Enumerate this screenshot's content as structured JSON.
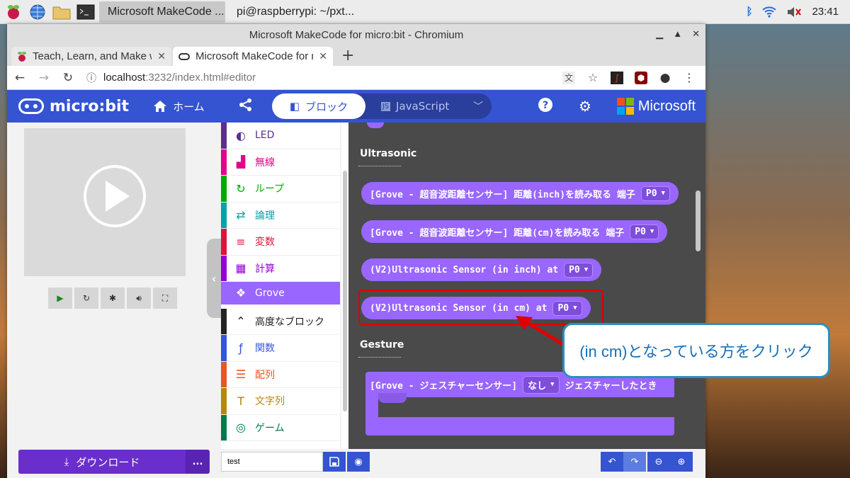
{
  "taskbar": {
    "tasks": [
      {
        "label": "Microsoft MakeCode ...",
        "active": true
      },
      {
        "label": "pi@raspberrypi: ~/pxt...",
        "active": false
      }
    ],
    "clock": "23:41"
  },
  "window": {
    "title": "Microsoft MakeCode for micro:bit - Chromium",
    "tabs": [
      {
        "title": "Teach, Learn, and Make w",
        "close": "✕"
      },
      {
        "title": "Microsoft MakeCode for m",
        "close": "✕"
      }
    ],
    "new_tab": "+",
    "url_host": "localhost",
    "url_rest": ":3232/index.html#editor"
  },
  "header": {
    "logo": "micro:bit",
    "home_label": "ホーム",
    "mode_blocks": "ブロック",
    "mode_js": "JavaScript",
    "brand": "Microsoft"
  },
  "toolbox": {
    "categories": [
      {
        "label": "LED",
        "color": "#5c2d91",
        "icon": "◐"
      },
      {
        "label": "無線",
        "color": "#e3008c",
        "icon": "▟"
      },
      {
        "label": "ループ",
        "color": "#00aa00",
        "icon": "↻"
      },
      {
        "label": "論理",
        "color": "#00a4a6",
        "icon": "⇄"
      },
      {
        "label": "変数",
        "color": "#dc143c",
        "icon": "≡"
      },
      {
        "label": "計算",
        "color": "#9400d3",
        "icon": "▦"
      },
      {
        "label": "Grove",
        "color": "#9966ff",
        "icon": "❖"
      },
      {
        "label": "高度なブロック",
        "color": "#222222",
        "icon": "⌃"
      },
      {
        "label": "関数",
        "color": "#3455db",
        "icon": "ƒ"
      },
      {
        "label": "配列",
        "color": "#e65722",
        "icon": "☰"
      },
      {
        "label": "文字列",
        "color": "#b8860b",
        "icon": "T"
      },
      {
        "label": "ゲーム",
        "color": "#007a4b",
        "icon": "◎"
      }
    ]
  },
  "flyout": {
    "ultrasonic_heading": "Ultrasonic",
    "gesture_heading": "Gesture",
    "blocks": [
      {
        "text": "[Grove - 超音波距離センサー] 距離(inch)を読み取る 端子",
        "pin": "P0"
      },
      {
        "text": "[Grove - 超音波距離センサー] 距離(cm)を読み取る 端子",
        "pin": "P0"
      },
      {
        "text": "(V2)Ultrasonic Sensor (in inch) at",
        "pin": "P0"
      },
      {
        "text": "(V2)Ultrasonic Sensor (in cm) at",
        "pin": "P0"
      }
    ],
    "gesture_block": {
      "prefix": "[Grove - ジェスチャーセンサー]",
      "dropdown": "なし",
      "suffix": "ジェスチャーしたとき"
    }
  },
  "annotation": {
    "callout": "(in cm)となっている方をクリック",
    "highlight_color": "#e00000",
    "arrow_color": "#e00000"
  },
  "bottom": {
    "download_label": "ダウンロード",
    "more": "...",
    "project_name": "test"
  }
}
